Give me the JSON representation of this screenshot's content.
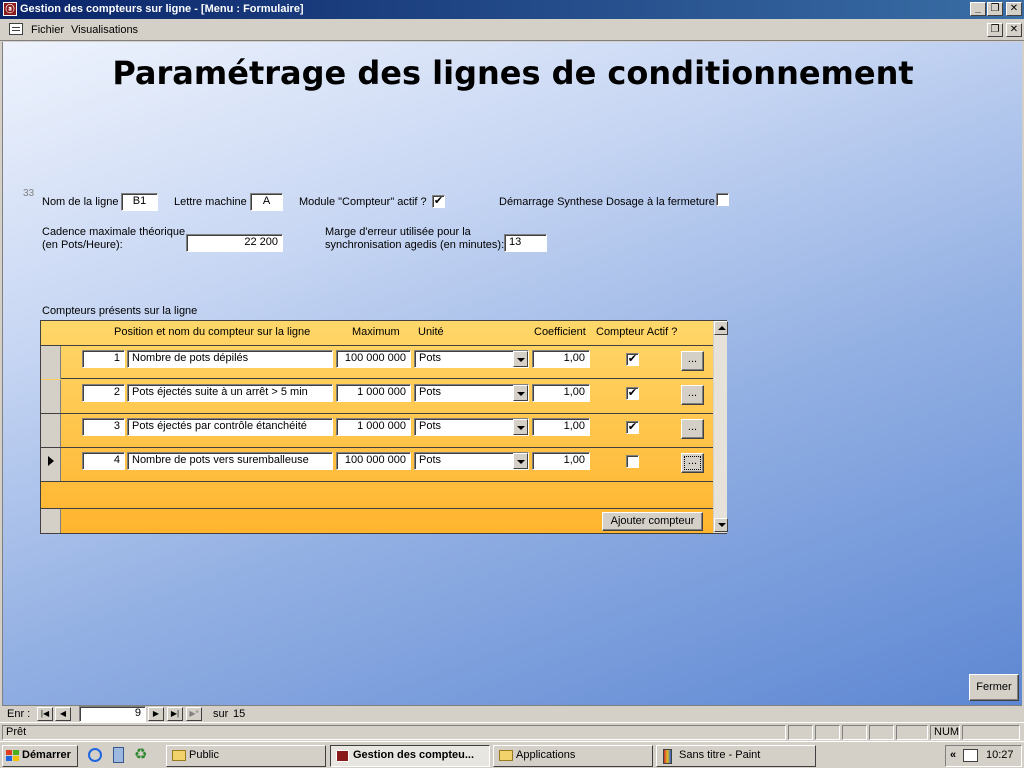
{
  "window": {
    "title": "Gestion des compteurs sur ligne - [Menu : Formulaire]",
    "btn_minimize": "_",
    "btn_restore": "❐",
    "btn_close": "✕"
  },
  "menu": {
    "items": [
      "Fichier",
      "Visualisations"
    ],
    "btn_restore": "❐",
    "btn_close": "✕"
  },
  "form": {
    "title": "Paramétrage des lignes de conditionnement",
    "id_number": "33",
    "nom_ligne_label": "Nom de la ligne",
    "nom_ligne_value": "B1",
    "lettre_label": "Lettre machine",
    "lettre_value": "A",
    "module_label": "Module \"Compteur\" actif ?",
    "module_checked": "✔",
    "demarrage_label": "Démarrage Synthese Dosage à la fermeture",
    "demarrage_checked": "",
    "cadence_label_1": "Cadence maximale théorique",
    "cadence_label_2": "(en Pots/Heure):",
    "cadence_value": "22 200",
    "marge_label_1": "Marge d'erreur utilisée pour la",
    "marge_label_2": "synchronisation agedis (en minutes):",
    "marge_value": "13",
    "subform_caption": "Compteurs présents sur la ligne",
    "fermer_label": "Fermer"
  },
  "counters": {
    "headers": {
      "position": "Position et nom du compteur sur la ligne",
      "maximum": "Maximum",
      "unite": "Unité",
      "coefficient": "Coefficient",
      "actif": "Compteur Actif ?"
    },
    "rows": [
      {
        "pos": "1",
        "name": "Nombre de pots dépilés",
        "max": "100 000 000",
        "unit": "Pots",
        "coef": "1,00",
        "actif": "✔",
        "more": "..."
      },
      {
        "pos": "2",
        "name": "Pots éjectés suite à un arrêt > 5 min",
        "max": "1 000 000",
        "unit": "Pots",
        "coef": "1,00",
        "actif": "✔",
        "more": "..."
      },
      {
        "pos": "3",
        "name": "Pots éjectés par contrôle étanchéité",
        "max": "1 000 000",
        "unit": "Pots",
        "coef": "1,00",
        "actif": "✔",
        "more": "..."
      },
      {
        "pos": "4",
        "name": "Nombre de pots vers suremballeuse",
        "max": "100 000 000",
        "unit": "Pots",
        "coef": "1,00",
        "actif": "",
        "more": "..."
      }
    ],
    "add_button": "Ajouter compteur"
  },
  "navigation": {
    "record_label": "Enr :",
    "first": "|◀",
    "prev": "◀",
    "current": "9",
    "next": "▶",
    "last": "▶|",
    "new": "▶*",
    "of_label": "sur",
    "total": "15"
  },
  "status": {
    "text": "Prêt",
    "num": "NUM"
  },
  "taskbar": {
    "start_label": "Démarrer",
    "tasks": [
      {
        "label": "Public",
        "active": false
      },
      {
        "label": "Gestion des compteu...",
        "active": true
      },
      {
        "label": "Applications",
        "active": false
      },
      {
        "label": "Sans titre - Paint",
        "active": false
      }
    ],
    "tray_arrows": "«",
    "clock": "10:27"
  },
  "colors": {
    "titlebar": "#0a246a",
    "form_gradient_top": "#eef3fd",
    "form_gradient_bottom": "#5d87d3",
    "subform": "#ffc44a"
  }
}
